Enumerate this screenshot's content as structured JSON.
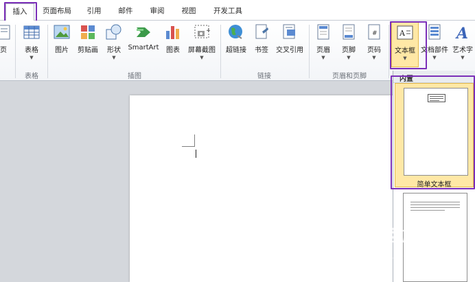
{
  "tabs": [
    {
      "label": "插入",
      "active": true
    },
    {
      "label": "页面布局"
    },
    {
      "label": "引用"
    },
    {
      "label": "邮件"
    },
    {
      "label": "审阅"
    },
    {
      "label": "视图"
    },
    {
      "label": "开发工具"
    }
  ],
  "ribbon": {
    "left_cut_label": "页",
    "table": {
      "label": "表格",
      "group": "表格"
    },
    "illustrations": {
      "group": "插图",
      "picture": "图片",
      "clipart": "剪贴画",
      "shapes": "形状",
      "smartart": "SmartArt",
      "chart": "图表",
      "screenshot": "屏幕截图"
    },
    "links": {
      "group": "链接",
      "hyperlink": "超链接",
      "bookmark": "书签",
      "crossref": "交叉引用"
    },
    "header_footer": {
      "group": "页眉和页脚",
      "header": "页眉",
      "footer": "页脚",
      "page_number": "页码"
    },
    "text": {
      "textbox": "文本框",
      "quickparts": "文档部件",
      "wordart": "艺术字"
    }
  },
  "gallery": {
    "heading": "内置",
    "item1_caption": "简单文本框"
  },
  "watermark": {
    "text": "搜狗指南",
    "url": "zhinan.sogou.com"
  },
  "colors": {
    "highlight": "#7b2fb8",
    "selected_fill": "#ffe8a6"
  }
}
